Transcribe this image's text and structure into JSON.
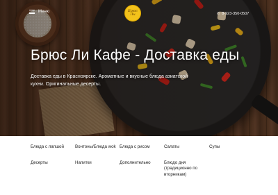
{
  "header": {
    "menu_label": "Меню",
    "logo_text": "Брюс Ли",
    "phone": "8-923-350-0507"
  },
  "hero": {
    "title": "Брюс Ли Кафе - Доставка еды",
    "description": "Доставка еды в Красноярске. Ароматные и вкусные блюда азиатской кухни. Оригинальные десерты."
  },
  "categories": [
    "Блюда с лапшой",
    "Вонтоны/Блюда wok",
    "Блюда с рисом",
    "Салаты",
    "Супы",
    "Десерты",
    "Напитки",
    "Дополнительно",
    "Блюдо дня (традиционно по вторникам)"
  ],
  "colors": {
    "logo_yellow": "#f3c21b",
    "text_dark": "#222222",
    "hero_text": "#ffffff"
  },
  "icons": {
    "menu": "hamburger-icon",
    "phone": "phone-icon"
  }
}
